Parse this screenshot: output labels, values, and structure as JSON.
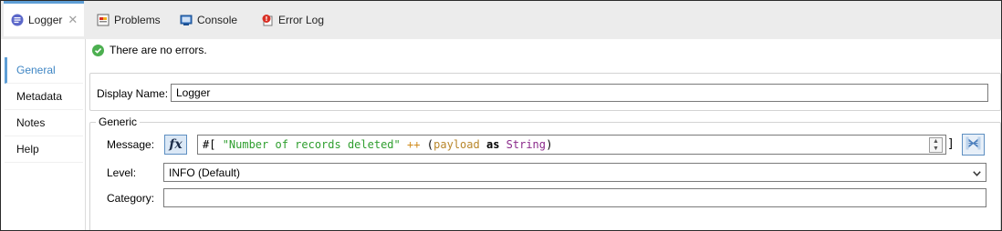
{
  "tabs": [
    {
      "label": "Logger",
      "icon": "logger-icon",
      "active": true,
      "closable": true
    },
    {
      "label": "Problems",
      "icon": "problems-icon"
    },
    {
      "label": "Console",
      "icon": "console-icon"
    },
    {
      "label": "Error Log",
      "icon": "error-log-icon"
    }
  ],
  "status": {
    "message": "There are no errors.",
    "icon": "check-circle-icon"
  },
  "sidenav": {
    "items": [
      {
        "label": "General",
        "active": true
      },
      {
        "label": "Metadata"
      },
      {
        "label": "Notes"
      },
      {
        "label": "Help"
      }
    ]
  },
  "form": {
    "display_name_label": "Display Name:",
    "display_name_value": "Logger",
    "group_title": "Generic",
    "message_label": "Message:",
    "fx_label": "fx",
    "expression": {
      "prefix": "#[",
      "string": "\"Number of records deleted\"",
      "op": "++",
      "open_paren": "(",
      "var": "payload",
      "keyword": "as",
      "type": "String",
      "close_paren": ")",
      "suffix": "]"
    },
    "level_label": "Level:",
    "level_value": "INFO (Default)",
    "category_label": "Category:",
    "category_value": ""
  },
  "colors": {
    "accent": "#5e9ed6",
    "string": "#2e9e2e",
    "operator": "#d08b1c",
    "type": "#8b2a8b",
    "ok": "#4caf50"
  }
}
